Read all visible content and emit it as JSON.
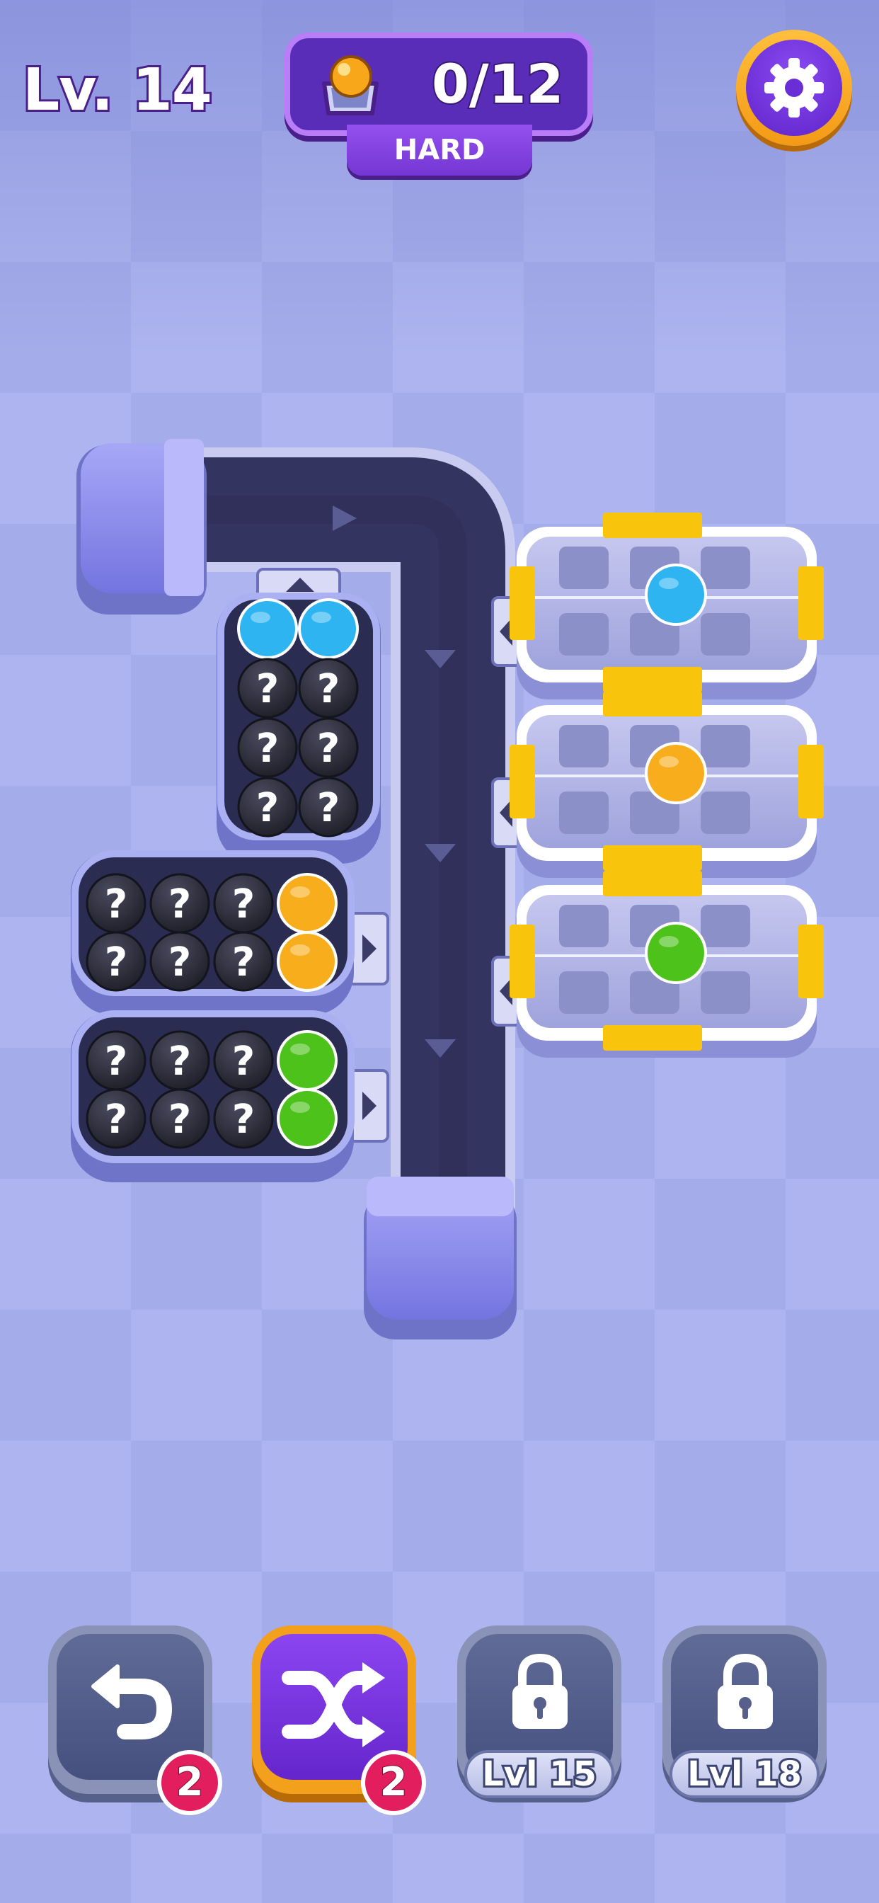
{
  "hud": {
    "level": "Lv. 14",
    "counter": "0/12",
    "difficulty": "HARD"
  },
  "colors": {
    "blue": "#2fb4f2",
    "orange": "#f8ae1c",
    "green": "#4cc21a",
    "mystery": "#2c2c3c",
    "conveyor": "#33345f",
    "tray_clip": "#f9c40c"
  },
  "ball_stacks": [
    {
      "name": "stack-top",
      "rows": [
        [
          "blue",
          "blue"
        ],
        [
          "?",
          "?"
        ],
        [
          "?",
          "?"
        ],
        [
          "?",
          "?"
        ]
      ]
    },
    {
      "name": "stack-middle",
      "rows": [
        [
          "?",
          "?",
          "?",
          "orange"
        ],
        [
          "?",
          "?",
          "?",
          "orange"
        ]
      ]
    },
    {
      "name": "stack-bottom",
      "rows": [
        [
          "?",
          "?",
          "?",
          "green"
        ],
        [
          "?",
          "?",
          "?",
          "green"
        ]
      ]
    }
  ],
  "mystery_mark": "?",
  "trays": [
    {
      "name": "tray-blue",
      "color": "blue",
      "filled": 1,
      "slots": 6
    },
    {
      "name": "tray-orange",
      "color": "orange",
      "filled": 1,
      "slots": 6
    },
    {
      "name": "tray-green",
      "color": "green",
      "filled": 1,
      "slots": 6
    }
  ],
  "boosters": {
    "undo": {
      "icon": "undo-icon",
      "count": "2"
    },
    "shuffle": {
      "icon": "shuffle-icon",
      "count": "2"
    },
    "locked_1": {
      "icon": "lock-icon",
      "label": "Lvl 15"
    },
    "locked_2": {
      "icon": "lock-icon",
      "label": "Lvl 18"
    }
  }
}
